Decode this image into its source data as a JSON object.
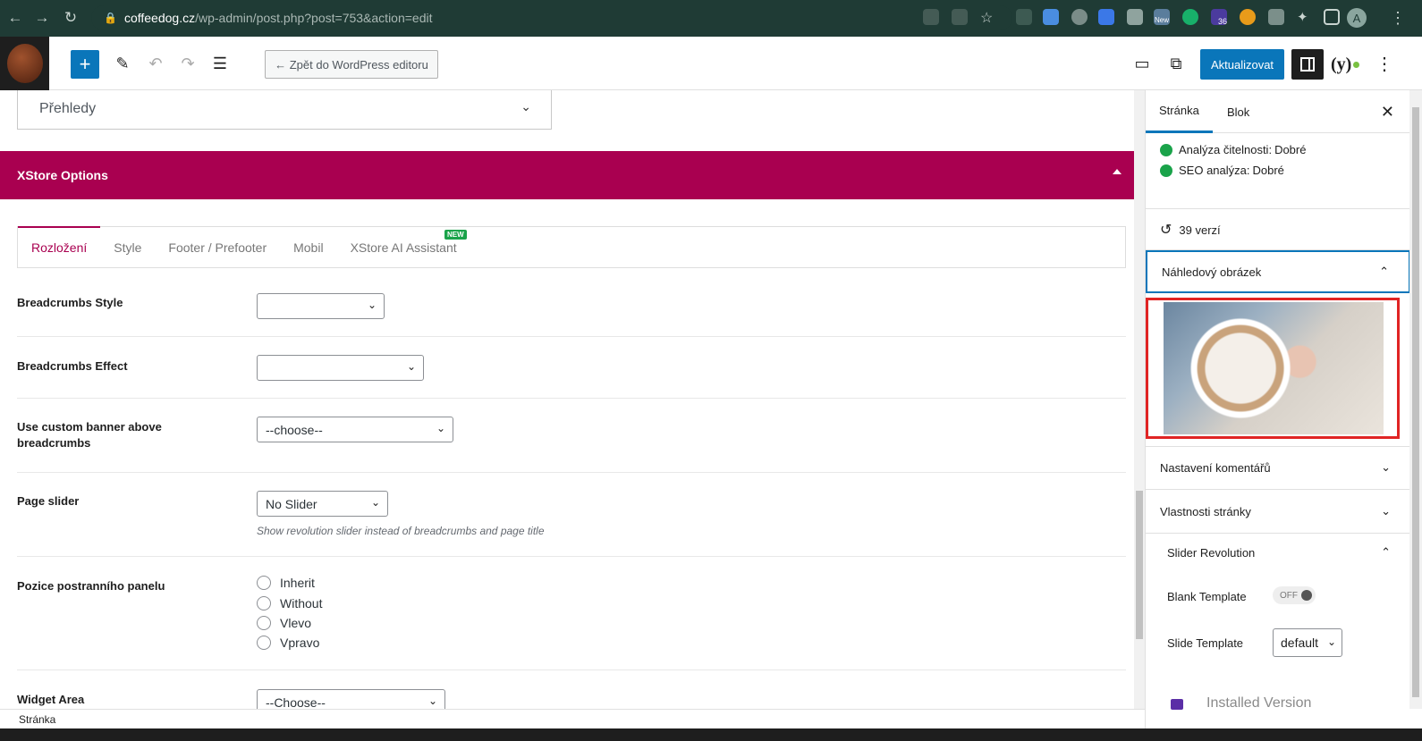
{
  "browser": {
    "url_host": "coffeedog.cz",
    "url_path": "/wp-admin/post.php?post=753&action=edit",
    "ext_badge": "36",
    "ext_new": "New",
    "profile_letter": "A"
  },
  "toolbar": {
    "back_label": "← Zpět do WordPress editoru",
    "update_label": "Aktualizovat"
  },
  "main": {
    "prehledy": "Přehledy",
    "xstore_title": "XStore Options",
    "tabs": [
      {
        "label": "Rozložení"
      },
      {
        "label": "Style"
      },
      {
        "label": "Footer / Prefooter"
      },
      {
        "label": "Mobil"
      },
      {
        "label": "XStore AI Assistant",
        "badge": "NEW"
      }
    ],
    "fields": {
      "breadcrumbs_style": {
        "label": "Breadcrumbs Style",
        "value": ""
      },
      "breadcrumbs_effect": {
        "label": "Breadcrumbs Effect",
        "value": ""
      },
      "custom_banner": {
        "label": "Use custom banner above breadcrumbs",
        "value": "--choose--"
      },
      "page_slider": {
        "label": "Page slider",
        "value": "No Slider",
        "hint": "Show revolution slider instead of breadcrumbs and page title"
      },
      "sidebar_position": {
        "label": "Pozice postranního panelu",
        "options": [
          "Inherit",
          "Without",
          "Vlevo",
          "Vpravo"
        ]
      },
      "widget_area": {
        "label": "Widget Area",
        "value": "--Choose--"
      }
    }
  },
  "status_bar": "Stránka",
  "sidebar": {
    "tab_page": "Stránka",
    "tab_block": "Blok",
    "readability_label": "Analýza čitelnosti:",
    "readability_value": "Dobré",
    "seo_label": "SEO analýza:",
    "seo_value": "Dobré",
    "revisions": "39 verzí",
    "featured_image": "Náhledový obrázek",
    "comments": "Nastavení komentářů",
    "page_attributes": "Vlastnosti stránky",
    "slider_revolution": "Slider Revolution",
    "blank_template_label": "Blank Template",
    "blank_template_toggle": "OFF",
    "slide_template_label": "Slide Template",
    "slide_template_value": "default",
    "installed_version": "Installed Version"
  },
  "colors": {
    "accent": "#0a76ba",
    "xstore": "#a90050",
    "highlight": "#e02424",
    "good": "#1aa34a"
  }
}
